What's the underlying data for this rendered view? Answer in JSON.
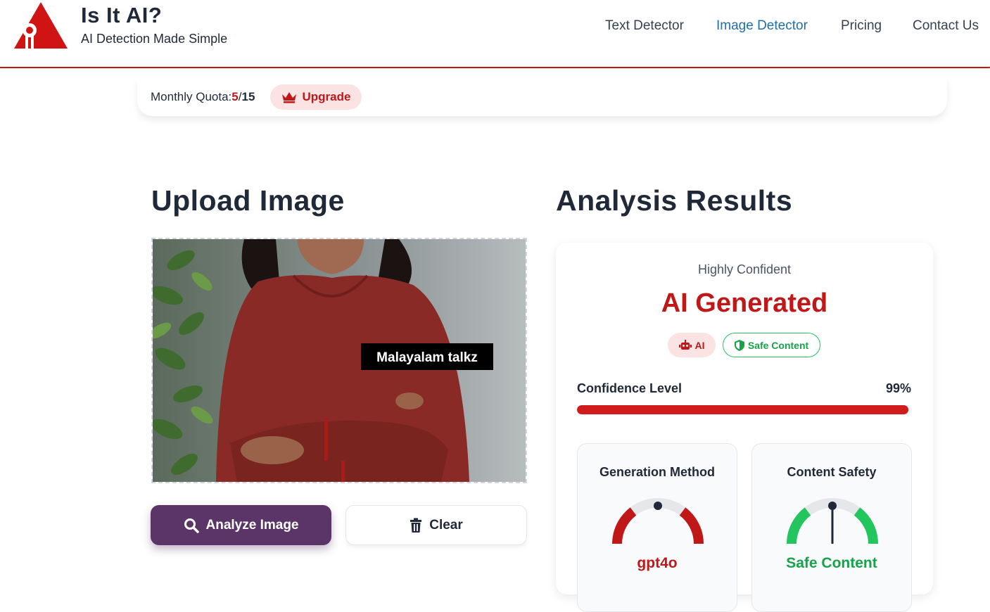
{
  "brand": {
    "title": "Is It AI?",
    "subtitle": "AI Detection Made Simple",
    "logo_icon": "red-triangle-eye-logo"
  },
  "nav": [
    {
      "label": "Text Detector",
      "active": false
    },
    {
      "label": "Image Detector",
      "active": true
    },
    {
      "label": "Pricing",
      "active": false
    },
    {
      "label": "Contact Us",
      "active": false
    }
  ],
  "quota": {
    "label": "Monthly Quota:",
    "used": "5",
    "separator": "/",
    "total": "15",
    "upgrade_label": "Upgrade",
    "upgrade_icon": "crown-icon"
  },
  "upload": {
    "title": "Upload Image",
    "image_caption": "Malayalam talkz",
    "analyze_label": "Analyze Image",
    "analyze_icon": "search-icon",
    "clear_label": "Clear",
    "clear_icon": "trash-icon"
  },
  "results": {
    "title": "Analysis Results",
    "confidence_text": "Highly Confident",
    "verdict": "AI Generated",
    "badges": {
      "ai": {
        "label": "AI",
        "icon": "robot-icon"
      },
      "safe": {
        "label": "Safe Content",
        "icon": "shield-icon"
      }
    },
    "confidence_label": "Confidence Level",
    "confidence_value": "99%",
    "confidence_fraction": 0.99,
    "generation": {
      "title": "Generation Method",
      "value": "gpt4o",
      "value_color": "#c01818"
    },
    "safety": {
      "title": "Content Safety",
      "value": "Safe Content",
      "value_color": "#16a34a"
    }
  },
  "colors": {
    "accent_red": "#c01818",
    "nav_active": "#1f6fa8",
    "primary_button": "#5b3567",
    "safe_green": "#22c55e"
  }
}
